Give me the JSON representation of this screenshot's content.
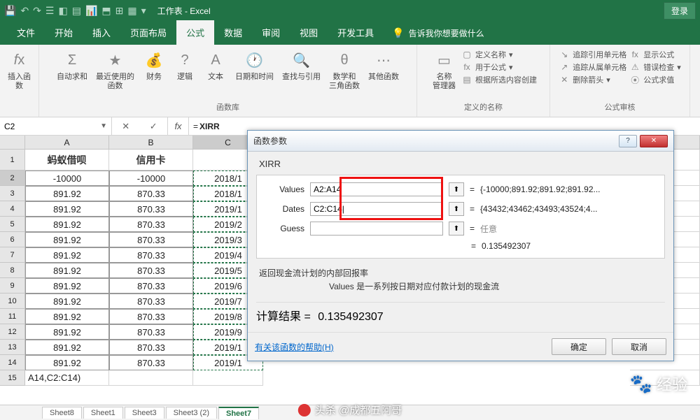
{
  "titlebar": {
    "app_title": "工作表 - Excel",
    "login": "登录"
  },
  "tabs": [
    "文件",
    "开始",
    "插入",
    "页面布局",
    "公式",
    "数据",
    "审阅",
    "视图",
    "开发工具"
  ],
  "active_tab": 4,
  "tell_me": "告诉我你想要做什么",
  "ribbon": {
    "insert_fn": "插入函数",
    "autosum": "自动求和",
    "recent": "最近使用的\n函数",
    "financial": "财务",
    "logic": "逻辑",
    "text": "文本",
    "date": "日期和时间",
    "lookup": "查找与引用",
    "math": "数学和\n三角函数",
    "other": "其他函数",
    "lib_label": "函数库",
    "name_mgr": "名称\n管理器",
    "def_name": "定义名称",
    "use_formula": "用于公式",
    "create_sel": "根据所选内容创建",
    "names_label": "定义的名称",
    "trace_prec": "追踪引用单元格",
    "trace_dep": "追踪从属单元格",
    "remove_arr": "删除箭头",
    "show_fx": "显示公式",
    "err_chk": "错误检查",
    "eval": "公式求值",
    "audit_label": "公式审核"
  },
  "namebox": "C2",
  "formula": {
    "prefix": "=",
    "fn": "XIRR",
    "body_mask": "A14,C2:C14)"
  },
  "columns": [
    "A",
    "B",
    "C",
    "K"
  ],
  "header_row": [
    "蚂蚁借呗",
    "信用卡",
    "",
    ""
  ],
  "data_rows": [
    [
      "-10000",
      "-10000",
      "2018/1"
    ],
    [
      "891.92",
      "870.33",
      "2018/1"
    ],
    [
      "891.92",
      "870.33",
      "2019/1"
    ],
    [
      "891.92",
      "870.33",
      "2019/2"
    ],
    [
      "891.92",
      "870.33",
      "2019/3"
    ],
    [
      "891.92",
      "870.33",
      "2019/4"
    ],
    [
      "891.92",
      "870.33",
      "2019/5"
    ],
    [
      "891.92",
      "870.33",
      "2019/6"
    ],
    [
      "891.92",
      "870.33",
      "2019/7"
    ],
    [
      "891.92",
      "870.33",
      "2019/8"
    ],
    [
      "891.92",
      "870.33",
      "2019/9"
    ],
    [
      "891.92",
      "870.33",
      "2019/1"
    ],
    [
      "891.92",
      "870.33",
      "2019/1"
    ]
  ],
  "cell_a15": "A14,C2:C14)",
  "dialog": {
    "title": "函数参数",
    "fn": "XIRR",
    "params": [
      {
        "label": "Values",
        "value": "A2:A14",
        "result": "{-10000;891.92;891.92;891.92..."
      },
      {
        "label": "Dates",
        "value": "C2:C14|",
        "result": "{43432;43462;43493;43524;4..."
      },
      {
        "label": "Guess",
        "value": "",
        "result": "任意"
      }
    ],
    "eq_result": "0.135492307",
    "desc1": "返回现金流计划的内部回报率",
    "desc2": "Values  是一系列按日期对应付款计划的现金流",
    "calc_result_label": "计算结果 =",
    "calc_result": "0.135492307",
    "help": "有关该函数的帮助(H)",
    "ok": "确定",
    "cancel": "取消"
  },
  "sheet_tabs": [
    "Sheet8",
    "Sheet1",
    "Sheet3",
    "Sheet3 (2)",
    "Sheet7"
  ],
  "active_sheet": 4,
  "watermark": "经验",
  "attribution": "头杀 @成都五阿哥"
}
